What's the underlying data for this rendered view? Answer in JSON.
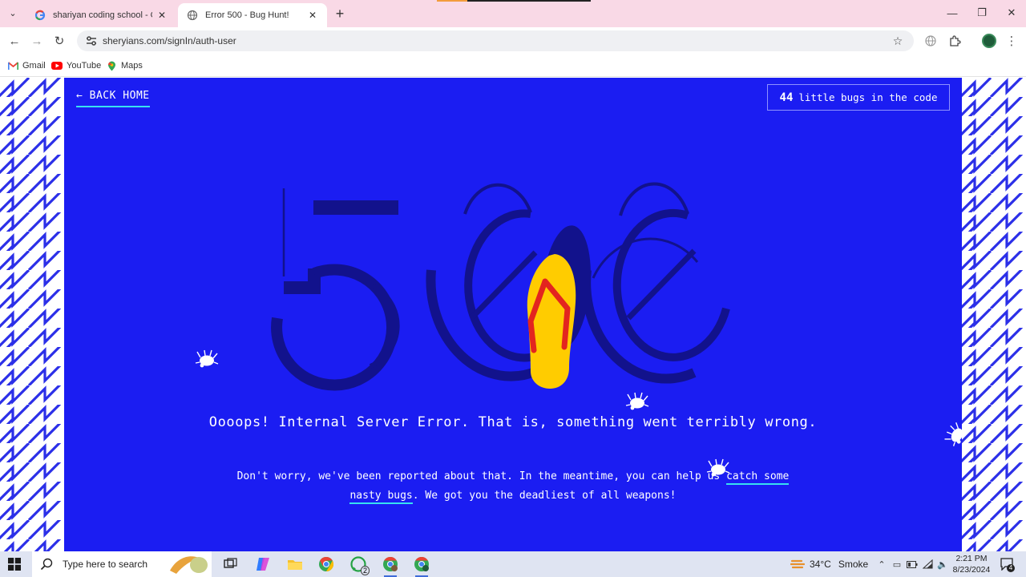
{
  "browser": {
    "tabs": [
      {
        "title": "shariyan coding school - Googl",
        "active": false
      },
      {
        "title": "Error 500 - Bug Hunt!",
        "active": true
      }
    ],
    "url": "sheryians.com/signIn/auth-user",
    "bookmarks": [
      {
        "label": "Gmail"
      },
      {
        "label": "YouTube"
      },
      {
        "label": "Maps"
      }
    ]
  },
  "page": {
    "back_home": "← BACK HOME",
    "bug_count": "44",
    "bug_count_label": "little bugs in the code",
    "error_code": "500",
    "headline": "Oooops! Internal Server Error. That is, something went terribly wrong.",
    "message_before": "Don't worry, we've been reported about that. In the meantime, you can help us",
    "message_link": "catch some nasty bugs",
    "message_after": ". We got you the deadliest of all weapons!",
    "colors": {
      "background": "#1b1df2",
      "digits": "#12128c",
      "accent_underline": "#38e0f0",
      "flipflop_sole": "#ffcc00",
      "flipflop_strap": "#e3251f"
    },
    "weapon_icon": "flip-flop-icon",
    "bug_icon": "bug-icon"
  },
  "taskbar": {
    "search_placeholder": "Type here to search",
    "whatsapp_badge": "2",
    "weather_temp": "34°C",
    "weather_desc": "Smoke",
    "time": "2:21 PM",
    "date": "8/23/2024",
    "notifications_count": "4"
  }
}
